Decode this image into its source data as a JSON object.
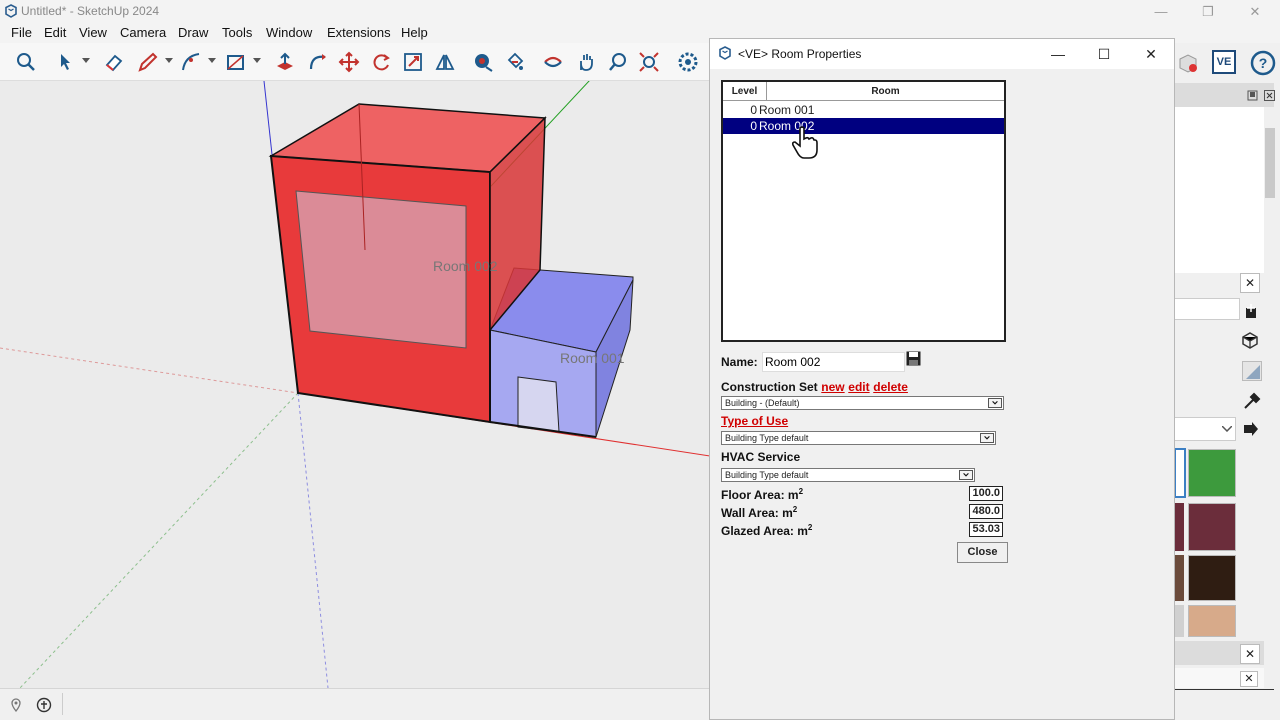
{
  "window": {
    "title": "Untitled* - SketchUp 2024",
    "minimize": "—",
    "restore": "❐",
    "close": "✕"
  },
  "menu": [
    "File",
    "Edit",
    "View",
    "Camera",
    "Draw",
    "Tools",
    "Window",
    "Extensions",
    "Help"
  ],
  "viewport": {
    "label_room_002": "Room 002",
    "label_room_001": "Room 001",
    "colors": {
      "red_room": "#e8393a",
      "blue_room": "#8d8ff0",
      "background": "#ebebeb"
    }
  },
  "dialog": {
    "title": "<VE> Room Properties",
    "table": {
      "headers": [
        "Level",
        "Room"
      ],
      "rows": [
        {
          "level": "0",
          "room": "Room 001",
          "selected": false
        },
        {
          "level": "0",
          "room": "Room 002",
          "selected": true
        }
      ]
    },
    "name_label": "Name:",
    "name_value": "Room 002",
    "construction_set_label": "Construction Set",
    "construction_links": [
      "new",
      "edit",
      "delete"
    ],
    "construction_value": "Building - (Default)",
    "type_of_use_label": "Type of Use",
    "type_of_use_value": "Building Type default",
    "hvac_label": "HVAC Service",
    "hvac_value": "Building Type default",
    "floor_area_label": "Floor Area: m",
    "floor_area_value": "100.0",
    "wall_area_label": "Wall Area: m",
    "wall_area_value": "480.0",
    "glazed_area_label": "Glazed Area: m",
    "glazed_area_value": "53.03",
    "sup": "2",
    "close_label": "Close"
  },
  "tray": {
    "ve_label": "VE",
    "swatch_colors": [
      "#3d9a3d",
      "#6b2d3b",
      "#2f1d12",
      "#d7aa8a"
    ]
  }
}
